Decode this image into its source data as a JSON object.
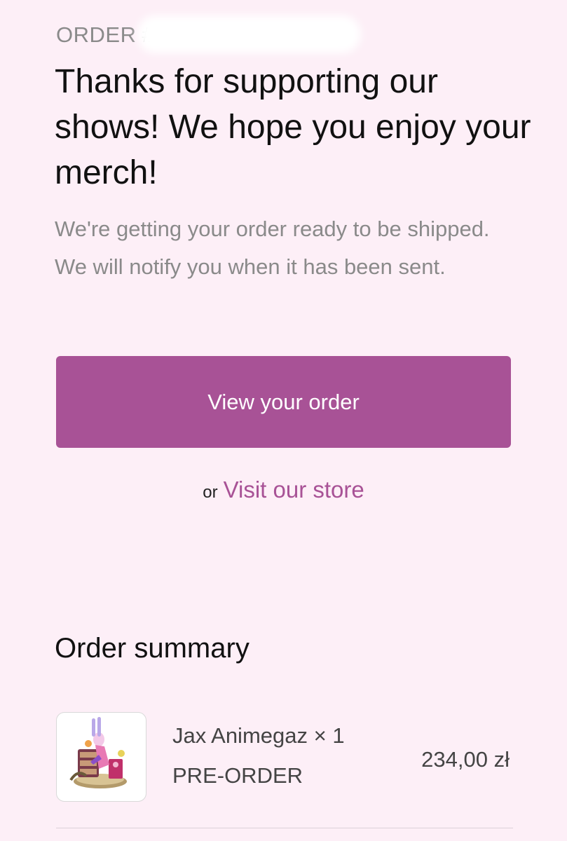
{
  "order": {
    "label": "ORDER",
    "number": "#"
  },
  "headline": "Thanks for supporting our shows! We hope you enjoy your merch!",
  "subtext": "We're getting your order ready to be shipped. We will notify you when it has been sent.",
  "actions": {
    "view_order_label": "View your order",
    "or_text": "or",
    "store_link_label": "Visit our store"
  },
  "summary": {
    "title": "Order summary",
    "items": [
      {
        "name": "Jax Animegaz × 1",
        "variant": "PRE-ORDER",
        "price": "234,00 zł"
      }
    ]
  },
  "colors": {
    "background": "#fdeff7",
    "accent": "#a85296",
    "muted_text": "#8a8a8a",
    "text": "#111111"
  },
  "icons": {
    "product_thumbnail": "figurine-thumbnail"
  }
}
